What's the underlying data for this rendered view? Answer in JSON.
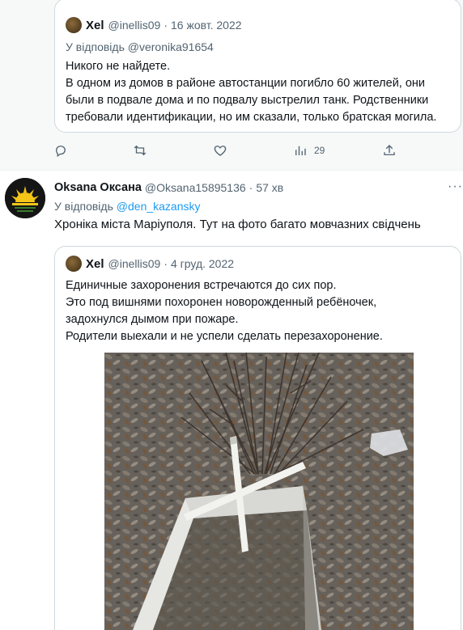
{
  "quoted_top": {
    "name": "Xel",
    "handle": "@inellis09",
    "separator": "·",
    "date": "16 жовт. 2022",
    "reply_to": "У відповідь @veronika91654",
    "lines": [
      "Никого не найдете.",
      "В одном из домов в районе автостанции погибло 60 жителей, они",
      "были в подвале дома и по подвалу выстрелил танк. Родственники",
      "требовали идентификации, но им сказали, только братская могила."
    ]
  },
  "actions": {
    "reply_icon": "reply-icon",
    "retweet_icon": "retweet-icon",
    "like_icon": "heart-icon",
    "views_icon": "views-icon",
    "views_count": "29",
    "share_icon": "share-icon"
  },
  "tweet": {
    "name": "Oksana Оксана",
    "handle": "@Oksana15895136",
    "separator": "·",
    "time": "57 хв",
    "more": "···",
    "reply_prefix": "У відповідь",
    "reply_to": "@den_kazansky",
    "text": "Хроніка міста Маріуполя. Тут на фото багато мовчазних свідчень"
  },
  "quoted_inner": {
    "name": "Xel",
    "handle": "@inellis09",
    "separator": "·",
    "date": "4 груд. 2022",
    "lines": [
      "Единичные захоронения встречаются до сих пор.",
      "Это под вишнями похоронен новорожденный ребёночек,",
      "задохнулся дымом при пожаре.",
      "Родители выехали и не успели сделать перезахоронение."
    ]
  },
  "colors": {
    "link": "#1d9bf0",
    "muted": "#536471",
    "border": "#cfd9de",
    "text": "#0f1419"
  }
}
